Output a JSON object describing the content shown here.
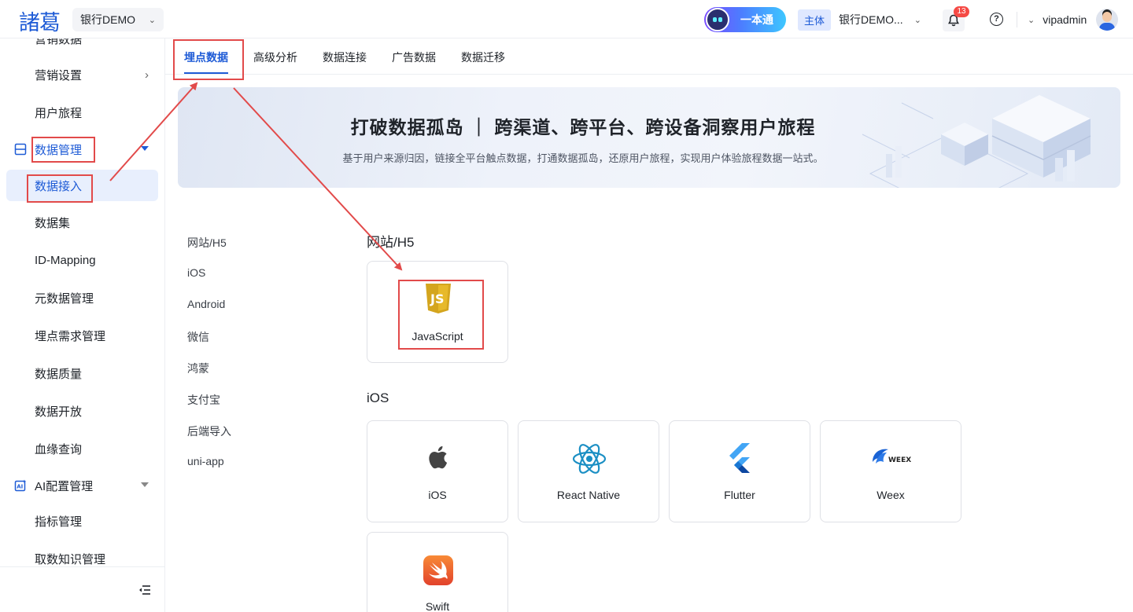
{
  "header": {
    "logo_text": "諸葛",
    "tenant": "银行DEMO",
    "ai_button": "一本通",
    "entity_tag": "主体",
    "entity_name": "银行DEMO...",
    "notification_count": "13",
    "help_glyph": "?",
    "username": "vipadmin"
  },
  "sidebar": {
    "partial_top": "营销数据",
    "items": [
      {
        "label": "营销设置"
      },
      {
        "label": "用户旅程"
      }
    ],
    "group_data": "数据管理",
    "sub_items": [
      {
        "label": "数据接入"
      },
      {
        "label": "数据集"
      },
      {
        "label": "ID-Mapping"
      },
      {
        "label": "元数据管理"
      },
      {
        "label": "埋点需求管理"
      },
      {
        "label": "数据质量"
      },
      {
        "label": "数据开放"
      },
      {
        "label": "血缘查询"
      }
    ],
    "group_ai": "AI配置管理",
    "ai_items": [
      {
        "label": "指标管理"
      },
      {
        "label": "取数知识管理"
      }
    ]
  },
  "tabs": [
    {
      "label": "埋点数据"
    },
    {
      "label": "高级分析"
    },
    {
      "label": "数据连接"
    },
    {
      "label": "广告数据"
    },
    {
      "label": "数据迁移"
    }
  ],
  "banner": {
    "title": "打破数据孤岛 ｜ 跨渠道、跨平台、跨设备洞察用户旅程",
    "subtitle": "基于用户来源归因，链接全平台触点数据，打通数据孤岛，还原用户旅程，实现用户体验旅程数据一站式。"
  },
  "categories": [
    "网站/H5",
    "iOS",
    "Android",
    "微信",
    "鸿蒙",
    "支付宝",
    "后端导入",
    "uni-app"
  ],
  "sections": {
    "web_title": "网站/H5",
    "web_cards": [
      {
        "label": "JavaScript",
        "icon": "javascript-icon"
      }
    ],
    "ios_title": "iOS",
    "ios_cards": [
      {
        "label": "iOS",
        "icon": "apple-icon"
      },
      {
        "label": "React Native",
        "icon": "react-icon"
      },
      {
        "label": "Flutter",
        "icon": "flutter-icon"
      },
      {
        "label": "Weex",
        "icon": "weex-icon"
      },
      {
        "label": "Swift",
        "icon": "swift-icon"
      }
    ]
  },
  "icon_texts": {
    "js": "JS",
    "weex": "WEEX"
  },
  "colors": {
    "accent": "#1e5bd6",
    "annotation": "#e24a4a",
    "badge": "#f54a45"
  }
}
